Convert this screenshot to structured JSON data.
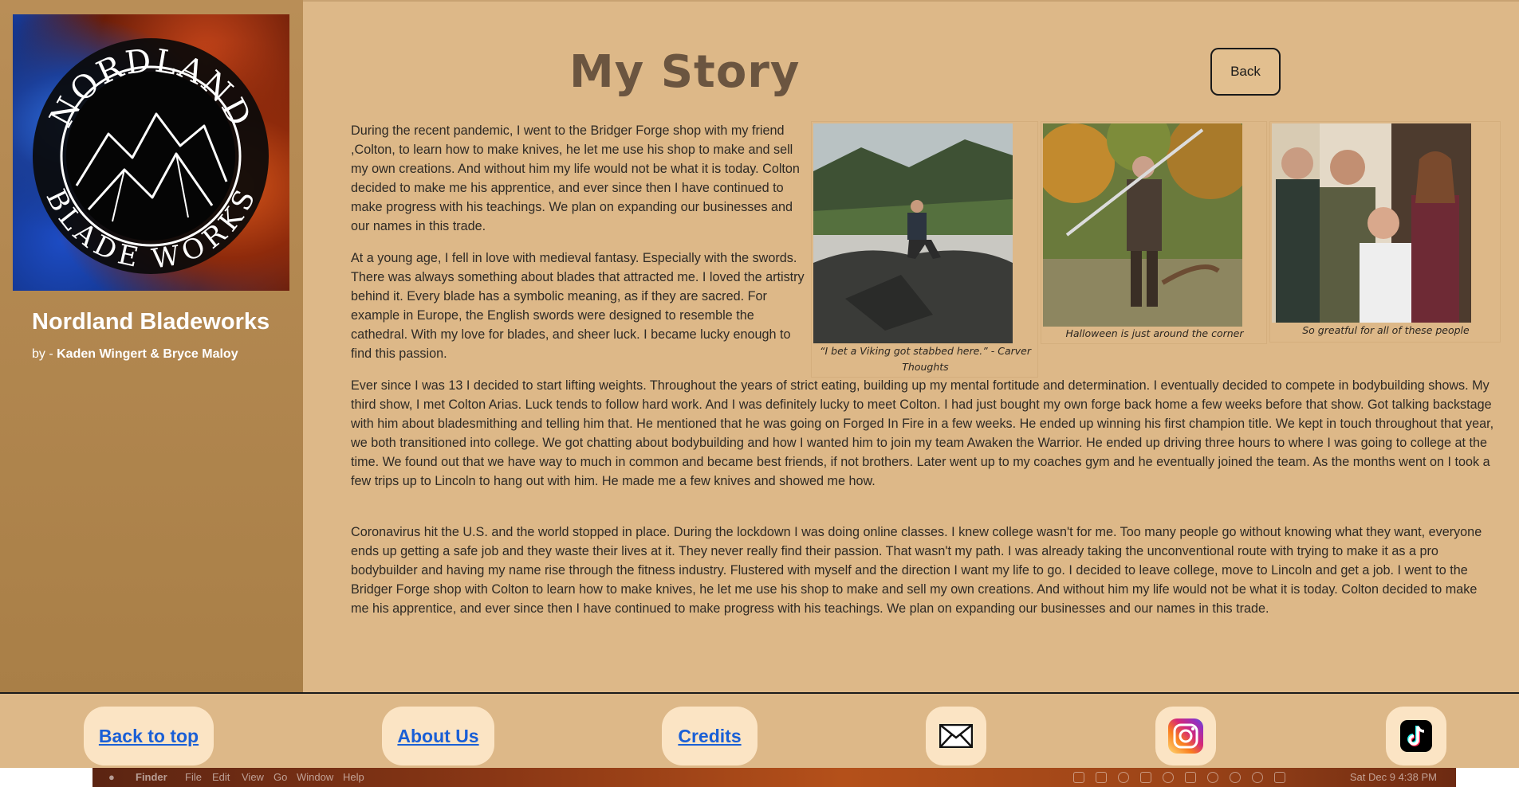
{
  "sidebar": {
    "brand_name": "Nordland Bladeworks",
    "by_prefix": "by - ",
    "authors": "Kaden Wingert & Bryce Maloy",
    "logo": {
      "top_text": "NORDLAND",
      "bottom_text": "BLADE WORKS"
    }
  },
  "main": {
    "title": "My Story",
    "back_label": "Back",
    "paragraphs": [
      "During the recent pandemic, I went to the Bridger Forge shop with my friend ,Colton, to learn how to make knives, he let me use his shop to make and sell my own creations. And without him my life would not be what it is today. Colton decided to make me his apprentice, and ever since then I have continued to make progress with his teachings. We plan on expanding our businesses and our names in this trade.",
      "At a young age, I fell in love with medieval fantasy. Especially with the swords. There was always something about blades that attracted me. I loved the artistry behind it. Every blade has a symbolic meaning, as if they are sacred. For example in Europe, the English swords were designed to resemble the cathedral. With my love for blades, and sheer luck. I became lucky enough to find this passion.",
      "Ever since I was 13 I decided to start lifting weights. Throughout the years of strict eating, building up my mental fortitude and determination. I eventually decided to compete in bodybuilding shows. My third show, I met Colton Arias. Luck tends to follow hard work. And I was definitely lucky to meet Colton. I had just bought my own forge back home a few weeks before that show. Got talking backstage with him about bladesmithing and telling him that. He mentioned that he was going on Forged In Fire in a few weeks. He ended up winning his first champion title. We kept in touch throughout that year, we both transitioned into college. We got chatting about bodybuilding and how I wanted him to join my team Awaken the Warrior. He ended up driving three hours to where I was going to college at the time. We found out that we have way to much in common and became best friends, if not brothers. Later went up to my coaches gym and he eventually joined the team. As the months went on I took a few trips up to Lincoln to hang out with him. He made me a few knives and showed me how.",
      "Coronavirus hit the U.S. and the world stopped in place. During the lockdown I was doing online classes. I knew college wasn't for me. Too many people go without knowing what they want, everyone ends up getting a safe job and they waste their lives at it. They never really find their passion. That wasn't my path. I was already taking the unconventional route with trying to make it as a pro bodybuilder and having my name rise through the fitness industry. Flustered with myself and the direction I want my life to go. I decided to leave college, move to Lincoln and get a job. I went to the Bridger Forge shop with Colton to learn how to make knives, he let me use his shop to make and sell my own creations. And without him my life would not be what it is today. Colton decided to make me his apprentice, and ever since then I have continued to make progress with his teachings. We plan on expanding our businesses and our names in this trade."
    ],
    "figures": [
      {
        "caption": "“I bet a Viking got stabbed here.” - Carver Thoughts"
      },
      {
        "caption": "Halloween is just around the corner"
      },
      {
        "caption": "So greatful for all of these people"
      }
    ]
  },
  "footer": {
    "back_to_top": "Back to top",
    "about_us": "About Us",
    "credits": "Credits"
  },
  "menubar": {
    "finder": "Finder",
    "items": [
      "File",
      "Edit",
      "View",
      "Go",
      "Window",
      "Help"
    ],
    "clock": "Sat Dec 9  4:38 PM"
  }
}
